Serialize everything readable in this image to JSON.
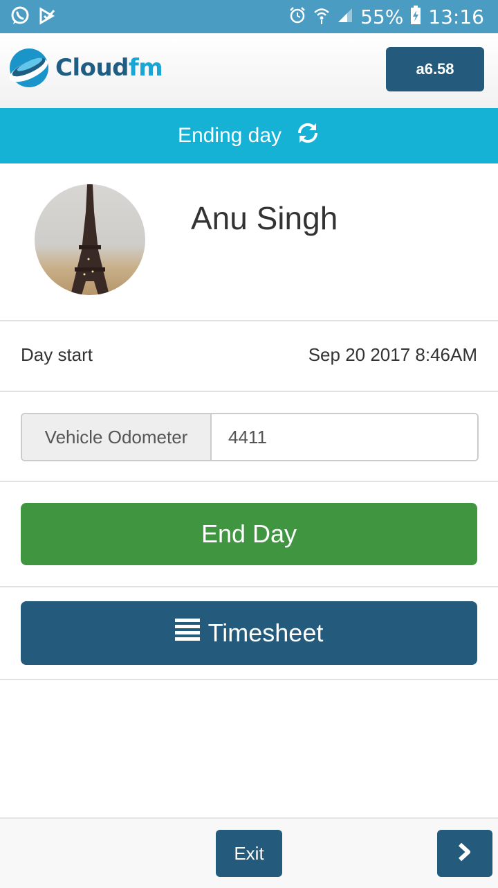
{
  "status_bar": {
    "battery": "55%",
    "time": "13:16",
    "left_icons": [
      "whatsapp-icon",
      "checkmark-flag-icon"
    ],
    "right_icons": [
      "alarm-icon",
      "wifi-icon",
      "signal-icon",
      "battery-charging-icon"
    ]
  },
  "header": {
    "logo_cloud": "Cloud",
    "logo_fm": "fm",
    "version": "a6.58"
  },
  "banner": {
    "text": "Ending day",
    "icon": "refresh-icon"
  },
  "profile": {
    "name": "Anu Singh"
  },
  "day_start": {
    "label": "Day start",
    "value": "Sep 20 2017 8:46AM"
  },
  "odometer": {
    "label": "Vehicle Odometer",
    "value": "4411"
  },
  "buttons": {
    "end_day": "End Day",
    "timesheet": "Timesheet",
    "exit": "Exit"
  },
  "colors": {
    "status_bar": "#4a9cc2",
    "banner": "#15b2d6",
    "primary": "#245b7c",
    "success": "#409640"
  }
}
